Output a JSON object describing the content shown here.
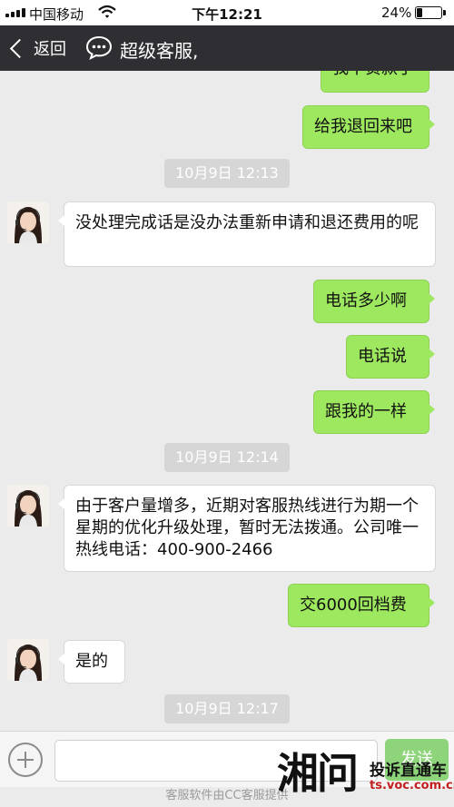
{
  "status_bar": {
    "carrier": "中国移动",
    "time": "下午12:21",
    "battery_pct": "24%",
    "battery_level": 0.24
  },
  "nav": {
    "back_label": "返回",
    "title": "超级客服,"
  },
  "messages": [
    {
      "type": "right",
      "text": "我不贷款了"
    },
    {
      "type": "right",
      "text": "给我退回来吧"
    },
    {
      "type": "time",
      "text": "10月9日 12:13"
    },
    {
      "type": "left",
      "text": "没处理完成话是没办法重新申请和退还费用的呢"
    },
    {
      "type": "right",
      "text": "电话多少啊"
    },
    {
      "type": "right",
      "text": "电话说"
    },
    {
      "type": "right",
      "text": "跟我的一样"
    },
    {
      "type": "time",
      "text": "10月9日 12:14"
    },
    {
      "type": "left",
      "text": "由于客户量增多，近期对客服热线进行为期一个星期的优化升级处理，暂时无法拨通。公司唯一热线电话：400-900-2466"
    },
    {
      "type": "right",
      "text": "交6000回档费"
    },
    {
      "type": "left",
      "text": "是的"
    },
    {
      "type": "time",
      "text": "10月9日 12:17"
    }
  ],
  "input_bar": {
    "send_label": "发送",
    "footer": "客服软件由CC客服提供"
  },
  "watermark": {
    "mark": "湘问",
    "line1": "投诉直通车",
    "line2": "ts.voc.com.cn"
  },
  "colors": {
    "nav_bg": "#2f2f33",
    "bubble_right": "#9ee85f",
    "bubble_left": "#ffffff",
    "chat_bg": "#ebebeb"
  }
}
